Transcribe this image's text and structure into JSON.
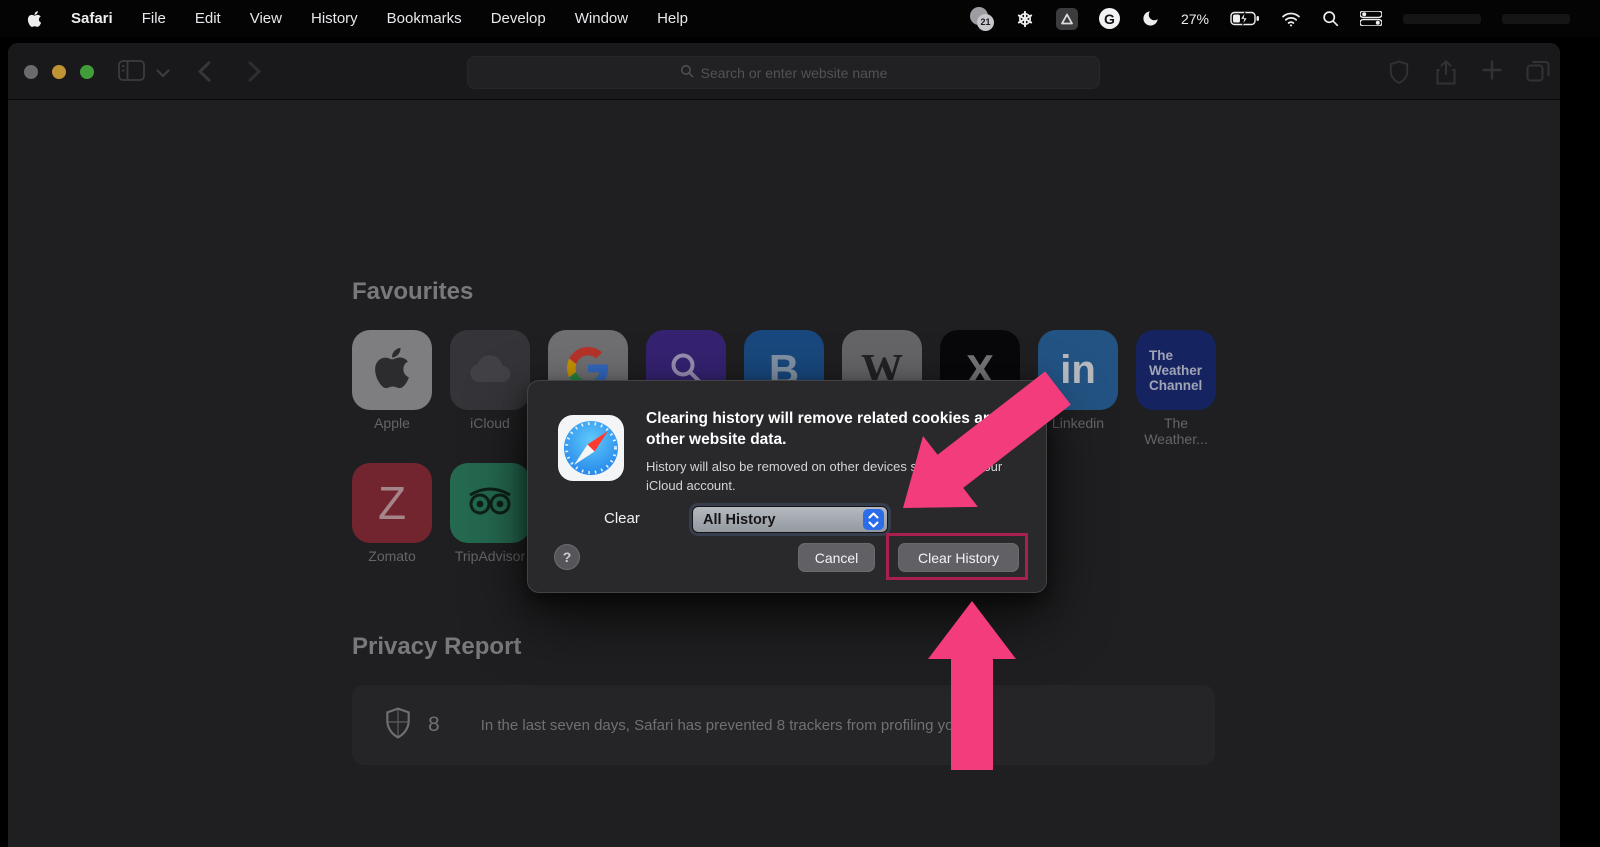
{
  "menu_bar": {
    "app_name": "Safari",
    "menus": [
      "File",
      "Edit",
      "View",
      "History",
      "Bookmarks",
      "Develop",
      "Window",
      "Help"
    ],
    "status": {
      "notification_badge": "21",
      "battery_percent": "27%"
    }
  },
  "toolbar": {
    "search_placeholder": "Search or enter website name"
  },
  "start_page": {
    "favourites_heading": "Favourites",
    "favourites": [
      {
        "label": "Apple"
      },
      {
        "label": "iCloud"
      },
      {
        "label": "",
        "glyph": ""
      },
      {
        "label": "",
        "glyph": ""
      },
      {
        "label": "",
        "glyph": "B"
      },
      {
        "label": "",
        "glyph": "W"
      },
      {
        "label": "",
        "glyph": "X"
      },
      {
        "label": "Linkedin",
        "glyph": "in"
      },
      {
        "label": "The Weather...",
        "glyph": "The Weather Channel"
      },
      {
        "label": "Zomato",
        "glyph": "Z"
      },
      {
        "label": "TripAdvisor"
      }
    ],
    "privacy_heading": "Privacy Report",
    "privacy": {
      "tracker_count": "8",
      "message": "In the last seven days, Safari has prevented 8 trackers from profiling you."
    }
  },
  "dialog": {
    "title": "Clearing history will remove related cookies and other website data.",
    "body": "History will also be removed on other devices signed into your iCloud account.",
    "clear_label": "Clear",
    "range_value": "All History",
    "help_label": "?",
    "cancel_label": "Cancel",
    "confirm_label": "Clear History"
  },
  "colors": {
    "annotation_pink": "#f23c7c",
    "annotation_outline": "#a92050",
    "accent_blue": "#2c6ce8"
  }
}
